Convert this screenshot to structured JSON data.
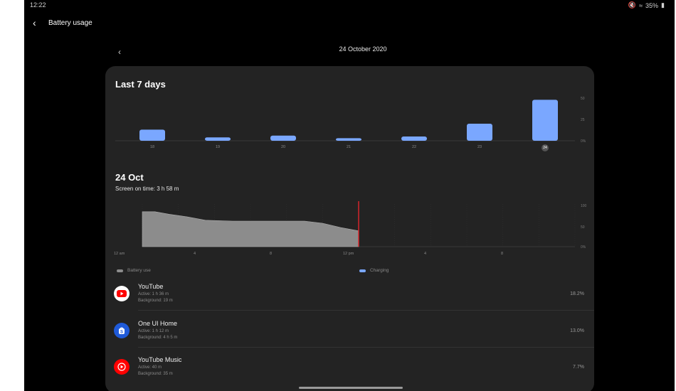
{
  "status": {
    "time": "12:22",
    "battery": "35%"
  },
  "appbar": {
    "title": "Battery usage"
  },
  "date_nav": {
    "date": "24 October 2020"
  },
  "week": {
    "title": "Last 7 days",
    "y_ticks": [
      "50",
      "25",
      "0%"
    ],
    "days": [
      "18",
      "19",
      "20",
      "21",
      "22",
      "23",
      "24"
    ],
    "selected_day": "24"
  },
  "day": {
    "title": "24 Oct",
    "screen_on": "Screen on time: 3 h 58 m",
    "y_ticks": [
      "100",
      "50",
      "0%"
    ],
    "x_ticks": [
      "12 am",
      "4",
      "8",
      "12 pm",
      "4",
      "8"
    ],
    "legend": {
      "battery": "Battery use",
      "charging": "Charging"
    }
  },
  "apps": [
    {
      "name": "YouTube",
      "active": "Active: 1 h 36 m",
      "background": "Background: 19 m",
      "percent": "18.2%",
      "icon": "youtube-icon",
      "color": "#ff0000"
    },
    {
      "name": "One UI Home",
      "active": "Active: 1 h 12 m",
      "background": "Background: 4 h 5 m",
      "percent": "13.0%",
      "icon": "one-ui-home-icon",
      "color": "#1f5ad8"
    },
    {
      "name": "YouTube Music",
      "active": "Active: 40 m",
      "background": "Background: 35 m",
      "percent": "7.7%",
      "icon": "youtube-music-icon",
      "color": "#ff0000"
    }
  ],
  "chart_data": [
    {
      "type": "bar",
      "title": "Last 7 days",
      "categories": [
        "18",
        "19",
        "20",
        "21",
        "22",
        "23",
        "24"
      ],
      "values": [
        13,
        4,
        6,
        3,
        5,
        20,
        48
      ],
      "ylim": [
        0,
        50
      ],
      "color": "#7aa7ff"
    },
    {
      "type": "area",
      "title": "24 Oct",
      "x": [
        0,
        0.7,
        1.5,
        2.5,
        3.5,
        5,
        6,
        7,
        8,
        9,
        10,
        11,
        12
      ],
      "values": [
        82,
        82,
        76,
        70,
        62,
        60,
        60,
        60,
        60,
        60,
        55,
        45,
        37
      ],
      "xlim": [
        0,
        24
      ],
      "ylim": [
        0,
        100
      ],
      "color": "#8c8c8c"
    }
  ]
}
